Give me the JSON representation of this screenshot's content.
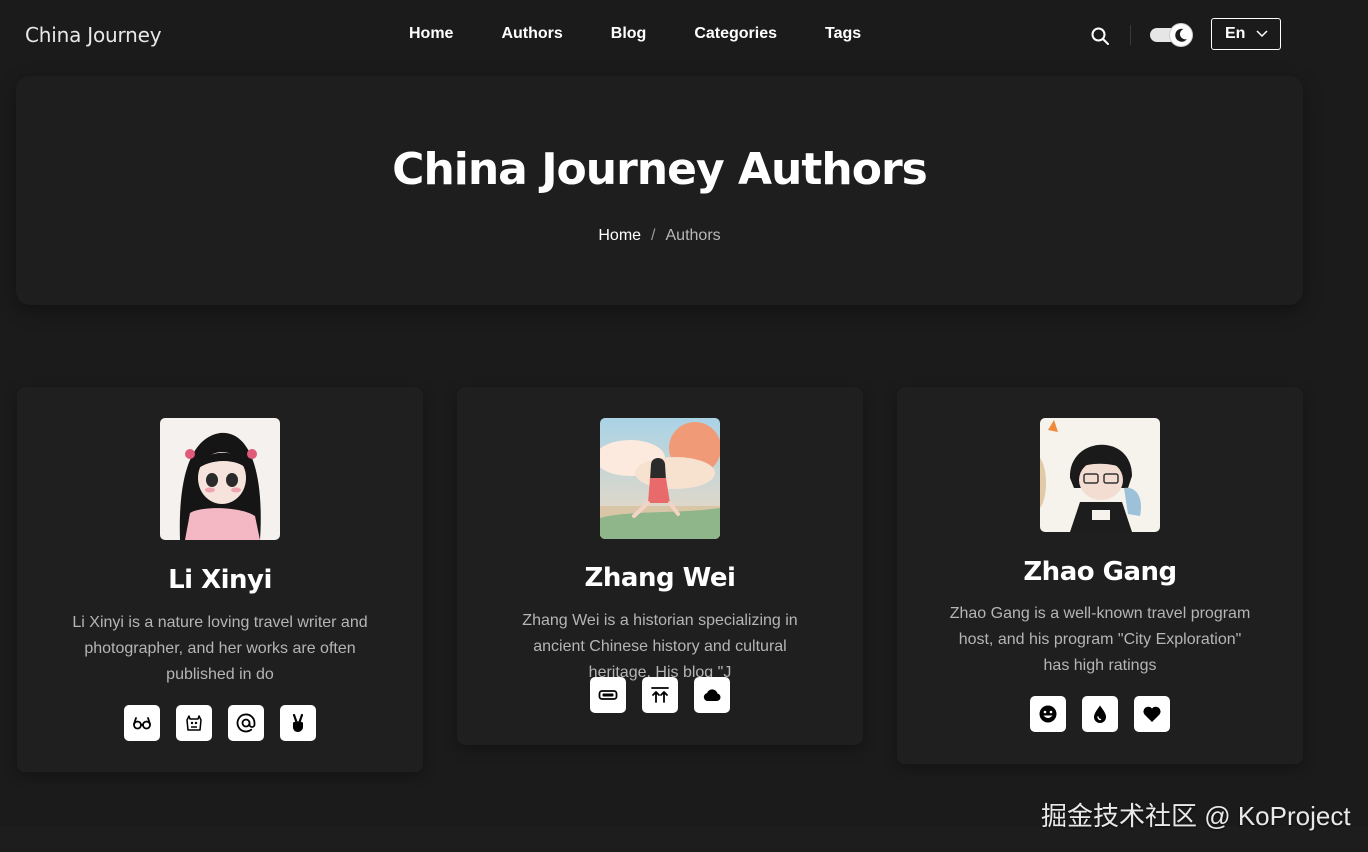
{
  "header": {
    "logo": "China Journey",
    "nav": [
      "Home",
      "Authors",
      "Blog",
      "Categories",
      "Tags"
    ],
    "language": "En"
  },
  "hero": {
    "title": "China Journey Authors",
    "breadcrumb": {
      "home": "Home",
      "separator": "/",
      "current": "Authors"
    }
  },
  "authors": [
    {
      "name": "Li Xinyi",
      "bio": "Li Xinyi is a nature loving travel writer and photographer, and her works are often published in do",
      "socials": [
        "glasses-icon",
        "hippo-icon",
        "at-sign-icon",
        "peace-hand-icon"
      ]
    },
    {
      "name": "Zhang Wei",
      "bio": "Zhang Wei is a historian specializing in ancient Chinese history and cultural heritage. His blog \"J",
      "socials": [
        "battery-icon",
        "upload-arrows-icon",
        "cloud-icon"
      ]
    },
    {
      "name": "Zhao Gang",
      "bio": "Zhao Gang is a well-known travel program host, and his program \"City Exploration\" has high ratings",
      "socials": [
        "smile-icon",
        "droplet-icon",
        "heart-icon"
      ]
    }
  ],
  "watermark": "掘金技术社区 @ KoProject",
  "colors": {
    "background": "#1b1b1b",
    "card": "#1f1f1f",
    "text": "#ffffff",
    "muted": "#b5b5b5"
  }
}
